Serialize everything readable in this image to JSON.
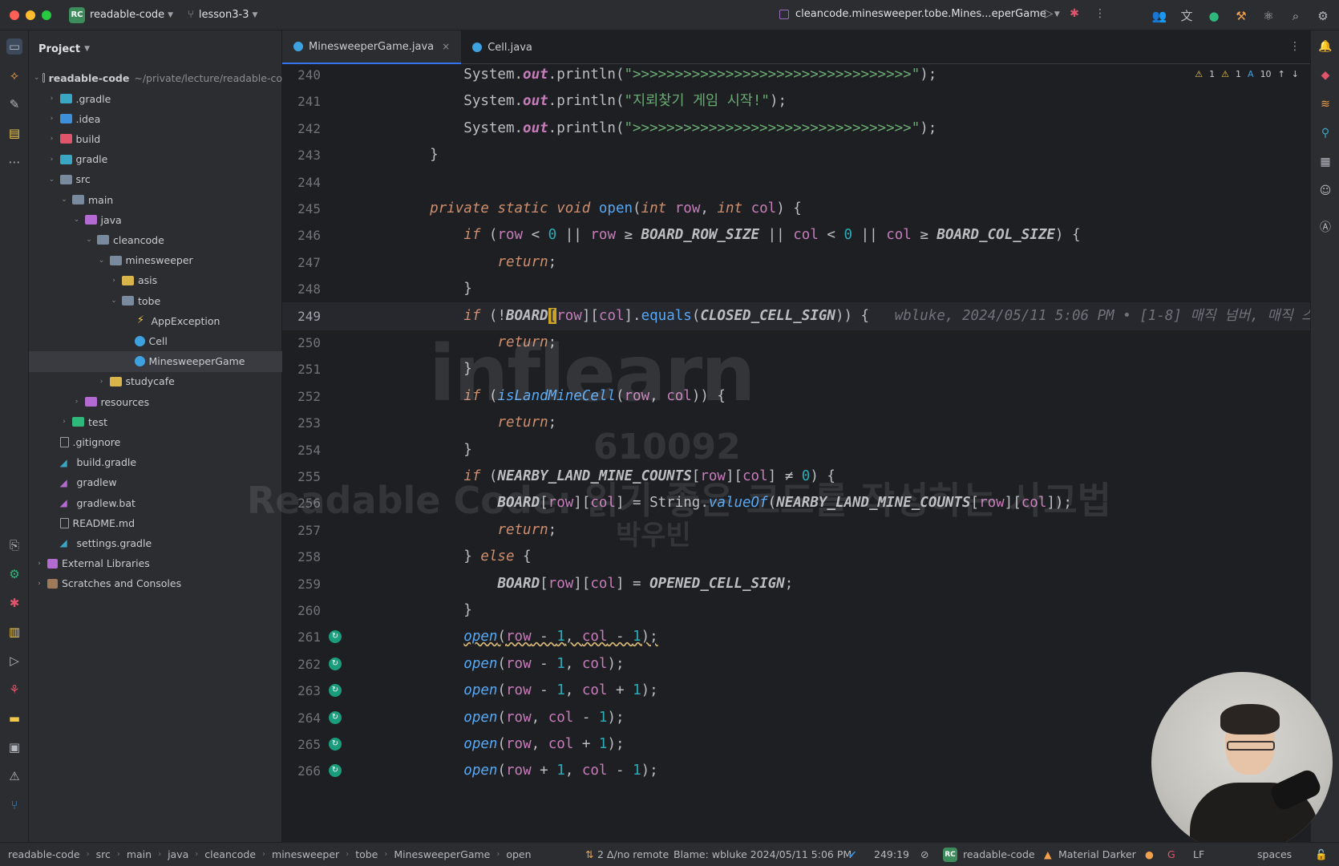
{
  "titlebar": {
    "project_badge": "RC",
    "project_name": "readable-code",
    "branch": "lesson3-3",
    "run_config": "cleancode.minesweeper.tobe.Mines...eperGame"
  },
  "project_panel": {
    "title": "Project",
    "root_name": "readable-code",
    "root_path": "~/private/lecture/readable-co",
    "items": [
      {
        "label": ".gradle",
        "depth": 1,
        "arrow": "›",
        "icon": "folder",
        "color": "#39a6c4"
      },
      {
        "label": ".idea",
        "depth": 1,
        "arrow": "›",
        "icon": "folder",
        "color": "#3c8fd8"
      },
      {
        "label": "build",
        "depth": 1,
        "arrow": "›",
        "icon": "folder",
        "color": "#e0556b"
      },
      {
        "label": "gradle",
        "depth": 1,
        "arrow": "›",
        "icon": "folder",
        "color": "#39a6c4"
      },
      {
        "label": "src",
        "depth": 1,
        "arrow": "⌄",
        "icon": "folder",
        "color": "#7a8a9e"
      },
      {
        "label": "main",
        "depth": 2,
        "arrow": "⌄",
        "icon": "folder",
        "color": "#7a8a9e"
      },
      {
        "label": "java",
        "depth": 3,
        "arrow": "⌄",
        "icon": "folder",
        "color": "#b36bd1"
      },
      {
        "label": "cleancode",
        "depth": 4,
        "arrow": "⌄",
        "icon": "folder",
        "color": "#7a8a9e"
      },
      {
        "label": "minesweeper",
        "depth": 5,
        "arrow": "⌄",
        "icon": "folder",
        "color": "#7a8a9e"
      },
      {
        "label": "asis",
        "depth": 6,
        "arrow": "›",
        "icon": "folder",
        "color": "#d8b44a"
      },
      {
        "label": "tobe",
        "depth": 6,
        "arrow": "⌄",
        "icon": "folder",
        "color": "#7a8a9e"
      },
      {
        "label": "AppException",
        "depth": 7,
        "arrow": "",
        "icon": "exception",
        "color": "#f2c84b"
      },
      {
        "label": "Cell",
        "depth": 7,
        "arrow": "",
        "icon": "class",
        "color": "#3fa2e0"
      },
      {
        "label": "MinesweeperGame",
        "depth": 7,
        "arrow": "",
        "icon": "class",
        "color": "#3fa2e0",
        "selected": true
      },
      {
        "label": "studycafe",
        "depth": 5,
        "arrow": "›",
        "icon": "folder",
        "color": "#d8b44a"
      },
      {
        "label": "resources",
        "depth": 3,
        "arrow": "›",
        "icon": "folder",
        "color": "#b36bd1"
      },
      {
        "label": "test",
        "depth": 2,
        "arrow": "›",
        "icon": "folder",
        "color": "#2fb87c"
      },
      {
        "label": ".gitignore",
        "depth": 1,
        "arrow": "",
        "icon": "file",
        "color": "#9da0a8"
      },
      {
        "label": "build.gradle",
        "depth": 1,
        "arrow": "",
        "icon": "gradle",
        "color": "#39a6c4"
      },
      {
        "label": "gradlew",
        "depth": 1,
        "arrow": "",
        "icon": "gradle",
        "color": "#b36bd1"
      },
      {
        "label": "gradlew.bat",
        "depth": 1,
        "arrow": "",
        "icon": "gradle",
        "color": "#b36bd1"
      },
      {
        "label": "README.md",
        "depth": 1,
        "arrow": "",
        "icon": "file",
        "color": "#9da0a8"
      },
      {
        "label": "settings.gradle",
        "depth": 1,
        "arrow": "",
        "icon": "gradle",
        "color": "#39a6c4"
      },
      {
        "label": "External Libraries",
        "depth": 0,
        "arrow": "›",
        "icon": "lib",
        "color": "#b36bd1"
      },
      {
        "label": "Scratches and Consoles",
        "depth": 0,
        "arrow": "›",
        "icon": "scratch",
        "color": "#a0785a"
      }
    ]
  },
  "tabs": [
    {
      "label": "MinesweeperGame.java",
      "active": true
    },
    {
      "label": "Cell.java",
      "active": false
    }
  ],
  "editor_status": {
    "warnings_a": "1",
    "warnings_b": "1",
    "typos": "10"
  },
  "code_lines": [
    {
      "n": "240",
      "html": "        System.<span class='out'>out</span>.println(<span class='st'>\">>>>>>>>>>>>>>>>>>>>>>>>>>>>>>>>>\"</span>);"
    },
    {
      "n": "241",
      "html": "        System.<span class='out'>out</span>.println(<span class='st'>\"지뢰찾기 게임 시작!\"</span>);"
    },
    {
      "n": "242",
      "html": "        System.<span class='out'>out</span>.println(<span class='st'>\">>>>>>>>>>>>>>>>>>>>>>>>>>>>>>>>>\"</span>);"
    },
    {
      "n": "243",
      "html": "    }"
    },
    {
      "n": "244",
      "html": ""
    },
    {
      "n": "245",
      "html": "    <span class='kw'>private static void</span> <span class='fn'>open</span>(<span class='kw'>int</span> <span class='par'>row</span>, <span class='kw'>int</span> <span class='par'>col</span>) {"
    },
    {
      "n": "246",
      "html": "        <span class='kw'>if</span> (<span class='par'>row</span> &lt; <span class='num'>0</span> || <span class='par'>row</span> ≥ <span class='bold-const'>BOARD_ROW_SIZE</span> || <span class='par'>col</span> &lt; <span class='num'>0</span> || <span class='par'>col</span> ≥ <span class='bold-const'>BOARD_COL_SIZE</span>) {"
    },
    {
      "n": "247",
      "html": "            <span class='kw'>return</span>;"
    },
    {
      "n": "248",
      "html": "        }"
    },
    {
      "n": "249",
      "html": "        <span class='kw'>if</span> (!<span class='bold-const'>BOARD</span><span class='caret-hl'>[</span><span class='par'>row</span>][<span class='par'>col</span>].<span class='fn'>equals</span>(<span class='bold-const'>CLOSED_CELL_SIGN</span>)) {   <span class='blame'>wbluke, 2024/05/11 5:06 PM • [1-8] 매직 넘버, 매직 스트링</span>",
      "current": true
    },
    {
      "n": "250",
      "html": "            <span class='kw'>return</span>;"
    },
    {
      "n": "251",
      "html": "        }"
    },
    {
      "n": "252",
      "html": "        <span class='kw'>if</span> (<span class='fn-i'>isLandMineCell</span>(<span class='par'>row</span>, <span class='par'>col</span>)) {"
    },
    {
      "n": "253",
      "html": "            <span class='kw'>return</span>;"
    },
    {
      "n": "254",
      "html": "        }"
    },
    {
      "n": "255",
      "html": "        <span class='kw'>if</span> (<span class='bold-const'>NEARBY_LAND_MINE_COUNTS</span>[<span class='par'>row</span>][<span class='par'>col</span>] ≠ <span class='num'>0</span>) {"
    },
    {
      "n": "256",
      "html": "            <span class='bold-const'>BOARD</span>[<span class='par'>row</span>][<span class='par'>col</span>] = String.<span class='fn-i'>valueOf</span>(<span class='bold-const'>NEARBY_LAND_MINE_COUNTS</span>[<span class='par'>row</span>][<span class='par'>col</span>]);"
    },
    {
      "n": "257",
      "html": "            <span class='kw'>return</span>;"
    },
    {
      "n": "258",
      "html": "        } <span class='kw'>else</span> {"
    },
    {
      "n": "259",
      "html": "            <span class='bold-const'>BOARD</span>[<span class='par'>row</span>][<span class='par'>col</span>] = <span class='bold-const'>OPENED_CELL_SIGN</span>;"
    },
    {
      "n": "260",
      "html": "        }"
    },
    {
      "n": "261",
      "html": "        <span class='squig'><span class='fn-i'>open</span>(<span class='par'>row</span> - <span class='num'>1</span>, <span class='par'>col</span> - <span class='num'>1</span>);</span>",
      "recursion": true
    },
    {
      "n": "262",
      "html": "        <span class='fn-i'>open</span>(<span class='par'>row</span> - <span class='num'>1</span>, <span class='par'>col</span>);",
      "recursion": true
    },
    {
      "n": "263",
      "html": "        <span class='fn-i'>open</span>(<span class='par'>row</span> - <span class='num'>1</span>, <span class='par'>col</span> + <span class='num'>1</span>);",
      "recursion": true
    },
    {
      "n": "264",
      "html": "        <span class='fn-i'>open</span>(<span class='par'>row</span>, <span class='par'>col</span> - <span class='num'>1</span>);",
      "recursion": true
    },
    {
      "n": "265",
      "html": "        <span class='fn-i'>open</span>(<span class='par'>row</span>, <span class='par'>col</span> + <span class='num'>1</span>);",
      "recursion": true
    },
    {
      "n": "266",
      "html": "        <span class='fn-i'>open</span>(<span class='par'>row</span> + <span class='num'>1</span>, <span class='par'>col</span> - <span class='num'>1</span>);",
      "recursion": true
    }
  ],
  "watermark": {
    "logo": "inflearn",
    "id": "610092",
    "course": "Readable Code: 읽기 좋은 코드를 작성하는 사고법",
    "author": "박우빈"
  },
  "statusbar": {
    "breadcrumb": [
      "readable-code",
      "src",
      "main",
      "java",
      "cleancode",
      "minesweeper",
      "tobe",
      "MinesweeperGame",
      "open"
    ],
    "vcs": "2 Δ/no remote",
    "blame": "Blame: wbluke 2024/05/11 5:06 PM",
    "position": "249:19",
    "project_badge": "RC",
    "project": "readable-code",
    "theme": "Material Darker",
    "line_sep": "LF",
    "indent": "spaces"
  }
}
